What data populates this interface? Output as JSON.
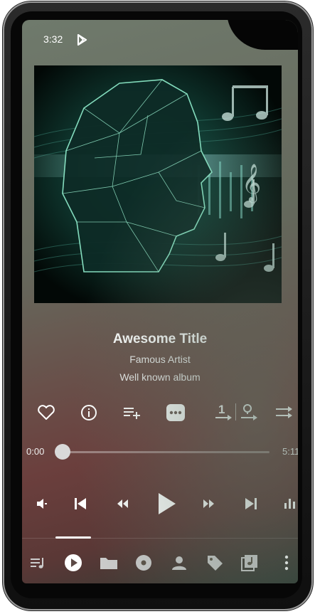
{
  "status_bar": {
    "time": "3:32",
    "icons": [
      "play-store-icon",
      "airplane-icon",
      "battery-icon"
    ]
  },
  "now_playing": {
    "title": "Awesome Title",
    "artist": "Famous Artist",
    "album": "Well known album"
  },
  "actions": [
    "favorite-icon",
    "info-icon",
    "add-to-queue-icon",
    "more-options-icon",
    "play-next-icon",
    "add-to-playlist-icon",
    "cast-icon"
  ],
  "progress": {
    "current": "0:00",
    "total": "5:11",
    "fraction": 0.0
  },
  "playback_controls": [
    "volume-icon",
    "previous-icon",
    "rewind-icon",
    "play-icon",
    "fast-forward-icon",
    "next-icon",
    "equalizer-icon"
  ],
  "bottom_nav": {
    "tabs": [
      "queue-tab",
      "now-playing-tab",
      "folders-tab",
      "albums-tab",
      "artists-tab",
      "tags-tab",
      "playlists-tab",
      "overflow-menu"
    ],
    "selected_tab": "now-playing-tab"
  },
  "colors": {
    "text": "#ffffff",
    "seek_track": "#9f8f8a",
    "thumb": "#d9d9d9"
  }
}
